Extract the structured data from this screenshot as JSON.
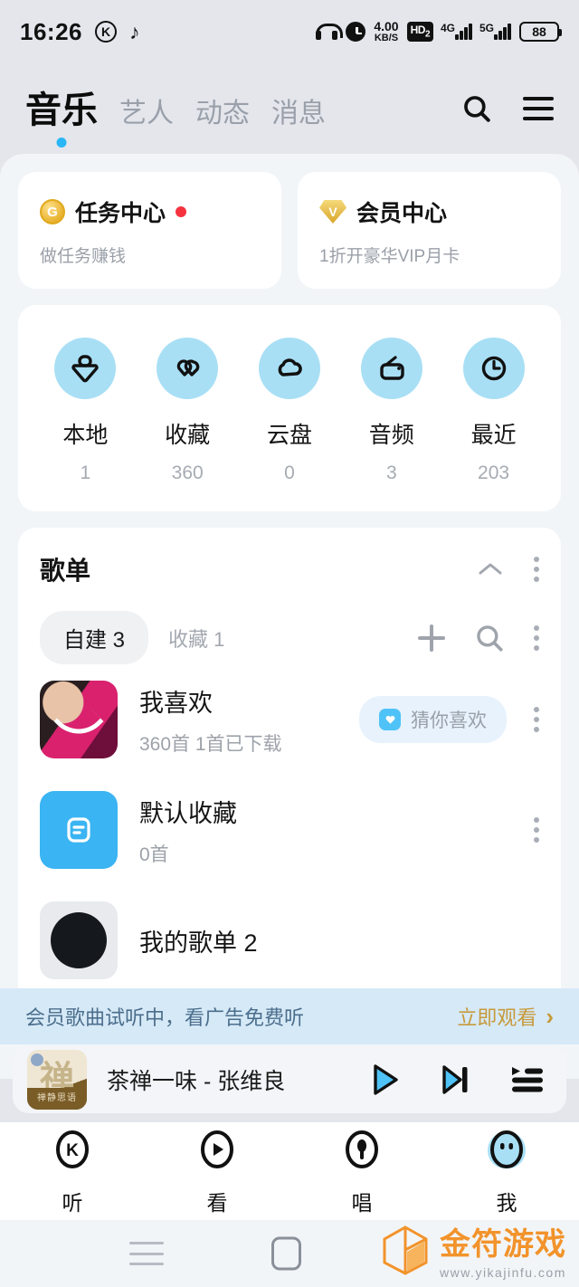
{
  "status_bar": {
    "time": "16:26",
    "app_icon_1": "kugou-k-icon",
    "app_icon_2": "tiktok-note-icon",
    "headphone_icon": "headphones-icon",
    "alarm_icon": "alarm-clock-icon",
    "net_speed": "4.00",
    "net_speed_unit": "KB/S",
    "hd_label": "HD",
    "hd_sub": "2",
    "sim1_label": "4G",
    "sim2_label": "5G",
    "battery": "88"
  },
  "header": {
    "tabs": [
      {
        "label": "音乐",
        "active": true
      },
      {
        "label": "艺人",
        "active": false
      },
      {
        "label": "动态",
        "active": false
      },
      {
        "label": "消息",
        "active": false
      }
    ],
    "search_icon": "search-icon",
    "menu_icon": "hamburger-menu-icon"
  },
  "promo_cards": [
    {
      "icon": "gold-coin-icon",
      "icon_letter": "G",
      "title": "任务中心",
      "has_badge": true,
      "subtitle": "做任务赚钱"
    },
    {
      "icon": "vip-diamond-icon",
      "icon_letter": "V",
      "title": "会员中心",
      "has_badge": false,
      "subtitle": "1折开豪华VIP月卡"
    }
  ],
  "quick_access": [
    {
      "icon": "local-download-icon",
      "label": "本地",
      "count": "1"
    },
    {
      "icon": "favorite-hearts-icon",
      "label": "收藏",
      "count": "360"
    },
    {
      "icon": "cloud-disk-icon",
      "label": "云盘",
      "count": "0"
    },
    {
      "icon": "radio-audio-icon",
      "label": "音频",
      "count": "3"
    },
    {
      "icon": "recent-clock-icon",
      "label": "最近",
      "count": "203"
    }
  ],
  "playlist_section": {
    "title": "歌单",
    "collapse_icon": "chevron-up-icon",
    "more_icon": "more-vertical-icon",
    "tabs": [
      {
        "label": "自建",
        "count": "3",
        "active": true
      },
      {
        "label": "收藏",
        "count": "1",
        "active": false
      }
    ],
    "add_icon": "plus-icon",
    "search_icon": "search-icon",
    "sort_icon": "more-vertical-icon",
    "items": [
      {
        "thumb": "photo-heart-thumb",
        "name": "我喜欢",
        "sub": "360首   1首已下载",
        "badge": "猜你喜欢",
        "badge_icon": "recommend-icon"
      },
      {
        "thumb": "blue-list-thumb",
        "name": "默认收藏",
        "sub": "0首",
        "badge": "",
        "badge_icon": ""
      },
      {
        "thumb": "dark-disc-thumb",
        "name": "我的歌单 2",
        "sub": "",
        "badge": "",
        "badge_icon": ""
      }
    ]
  },
  "ad_banner": {
    "text": "会员歌曲试听中，看广告免费听",
    "cta": "立即观看",
    "cta_arrow": "›"
  },
  "mini_player": {
    "art_char": "禅",
    "art_caption": "禅静思语",
    "title": "茶禅一味 - 张维良",
    "play_icon": "play-icon",
    "next_icon": "skip-next-icon",
    "queue_icon": "playlist-queue-icon"
  },
  "bottom_nav": [
    {
      "icon": "kugou-listen-icon",
      "label": "听",
      "active": false
    },
    {
      "icon": "watch-play-icon",
      "label": "看",
      "active": false
    },
    {
      "icon": "sing-mic-icon",
      "label": "唱",
      "active": false
    },
    {
      "icon": "profile-face-icon",
      "label": "我",
      "active": true
    }
  ],
  "android_nav": {
    "menu_icon": "android-menu-icon",
    "home_icon": "android-home-icon"
  },
  "watermark": {
    "icon": "cube-logo-icon",
    "text": "金符游戏",
    "url": "www.yikajinfu.com"
  },
  "colors": {
    "header_bg": "#E4E6EC",
    "page_bg": "#F2F5F8",
    "card_bg": "#FFFFFF",
    "accent_blue": "#29B6F6",
    "icon_circle": "#A8DFF5",
    "ad_bg": "#D6E9F7",
    "ad_cta": "#C79A3B",
    "badge_red": "#F5333F",
    "watermark_orange": "#F2932B"
  }
}
